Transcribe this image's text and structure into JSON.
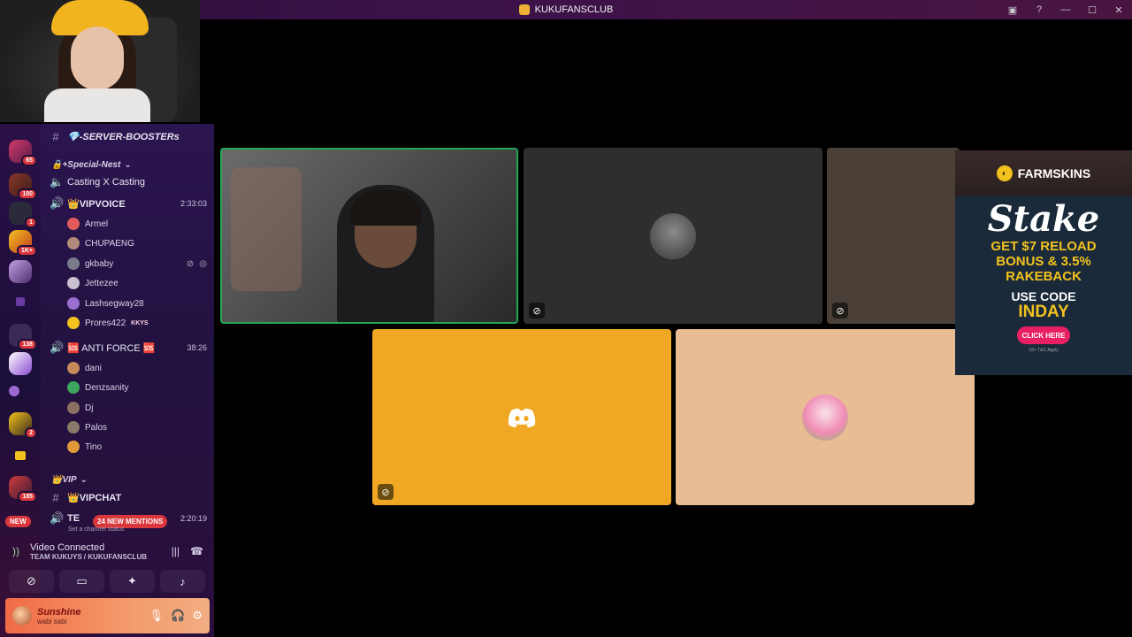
{
  "window": {
    "title": "KUKUFANSCLUB",
    "controls": [
      "inbox",
      "help",
      "minimize",
      "maximize",
      "close"
    ]
  },
  "servers": {
    "badges": [
      "65",
      "100",
      "1",
      "1K+",
      "138",
      "2",
      "185"
    ],
    "new_label": "NEW"
  },
  "channels": {
    "booster": "💎-SERVER-BOOSTERs",
    "special_nest": "🔒+Special-Nest",
    "casting": "Casting X Casting",
    "vipvoice": {
      "name": "👑VIPVOICE",
      "time": "2:33:03",
      "members": [
        {
          "name": "Armel",
          "color": "#e05a5a"
        },
        {
          "name": "CHUPAENG",
          "color": "#b08a7a"
        },
        {
          "name": "gkbaby",
          "color": "#7a7a8a"
        },
        {
          "name": "Jettezee",
          "color": "#c9c0d0"
        },
        {
          "name": "Lashsegway28",
          "color": "#9a6fd0"
        },
        {
          "name": "Prores422",
          "color": "#f2c21e",
          "tag": "KKYS"
        }
      ]
    },
    "antiforce": {
      "name": "🆘 ANTI FORCE 🆘",
      "time": "38:26",
      "members": [
        {
          "name": "dani",
          "color": "#c58a5a"
        },
        {
          "name": "Denzsanity",
          "color": "#3ba55c"
        },
        {
          "name": "Dj",
          "color": "#8a7060"
        },
        {
          "name": "Palos",
          "color": "#8a7a6a"
        },
        {
          "name": "Tino",
          "color": "#e09a3a"
        }
      ]
    },
    "vip_category": "👑VIP",
    "vipchat": "👑VIPCHAT",
    "team_channel": {
      "name": "TE",
      "time": "2:20:19",
      "status": "Set a channel status"
    },
    "mentions": "24 NEW MENTIONS"
  },
  "voice": {
    "title": "Video Connected",
    "subtitle": "TEAM KUKUYS / KUKUFANSCLUB"
  },
  "user": {
    "name": "Sunshine",
    "status": "wabi sabi"
  },
  "ad": {
    "brand_top": "FARMSKINS",
    "brand_main": "Stake",
    "promo_line1": "GET $7 RELOAD",
    "promo_line2": "BONUS & 3.5%",
    "promo_line3": "RAKEBACK",
    "use_code": "USE CODE",
    "code": "INDAY",
    "cta": "CLICK HERE",
    "fineprint": "18+ T&C Apply"
  },
  "icons": {
    "hash": "#",
    "speaker": "🔊",
    "mute": "🎙"
  }
}
